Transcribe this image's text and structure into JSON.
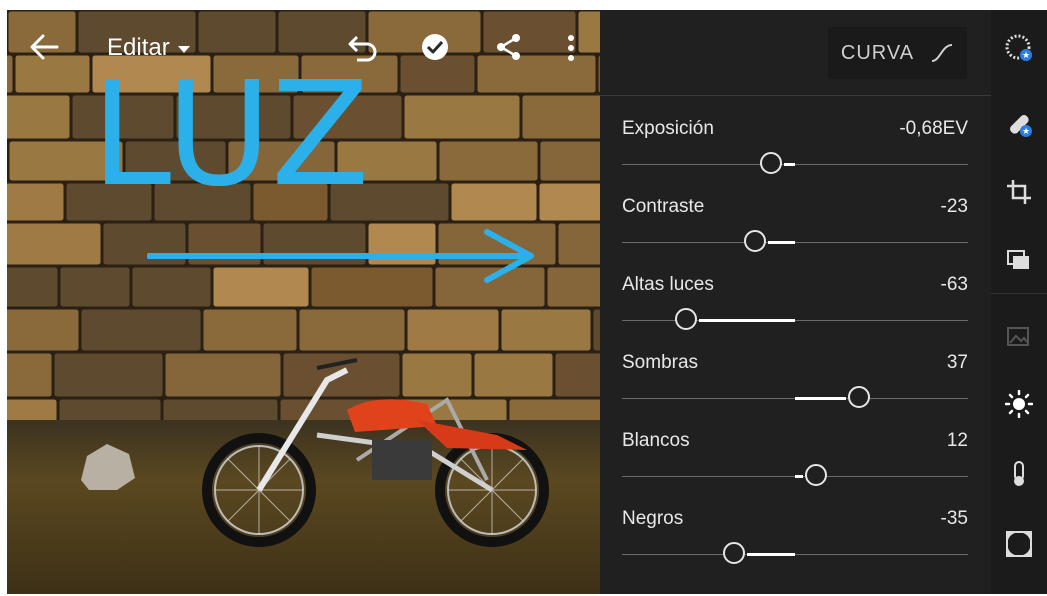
{
  "toolbar": {
    "back_icon": "arrow-left-icon",
    "mode_label": "Editar",
    "undo_icon": "undo-icon",
    "done_icon": "check-circle-icon",
    "share_icon": "share-icon",
    "more_icon": "more-vertical-icon"
  },
  "annotation": {
    "text": "LUZ",
    "color": "#2bb0ea"
  },
  "panel": {
    "curve_label": "CURVA",
    "curve_icon": "tone-curve-icon",
    "sliders": [
      {
        "label": "Exposición",
        "value_text": "-0,68EV",
        "position": 0.43
      },
      {
        "label": "Contraste",
        "value_text": "-23",
        "position": 0.385
      },
      {
        "label": "Altas luces",
        "value_text": "-63",
        "position": 0.185
      },
      {
        "label": "Sombras",
        "value_text": "37",
        "position": 0.685
      },
      {
        "label": "Blancos",
        "value_text": "12",
        "position": 0.56
      },
      {
        "label": "Negros",
        "value_text": "-35",
        "position": 0.325
      }
    ],
    "slider_center": 0.5
  },
  "tools": [
    {
      "name": "selective-icon"
    },
    {
      "name": "healing-icon"
    },
    {
      "name": "crop-icon"
    },
    {
      "name": "presets-icon"
    },
    {
      "name": "image-icon"
    },
    {
      "name": "light-icon"
    },
    {
      "name": "color-temperature-icon"
    },
    {
      "name": "vignette-icon"
    }
  ]
}
